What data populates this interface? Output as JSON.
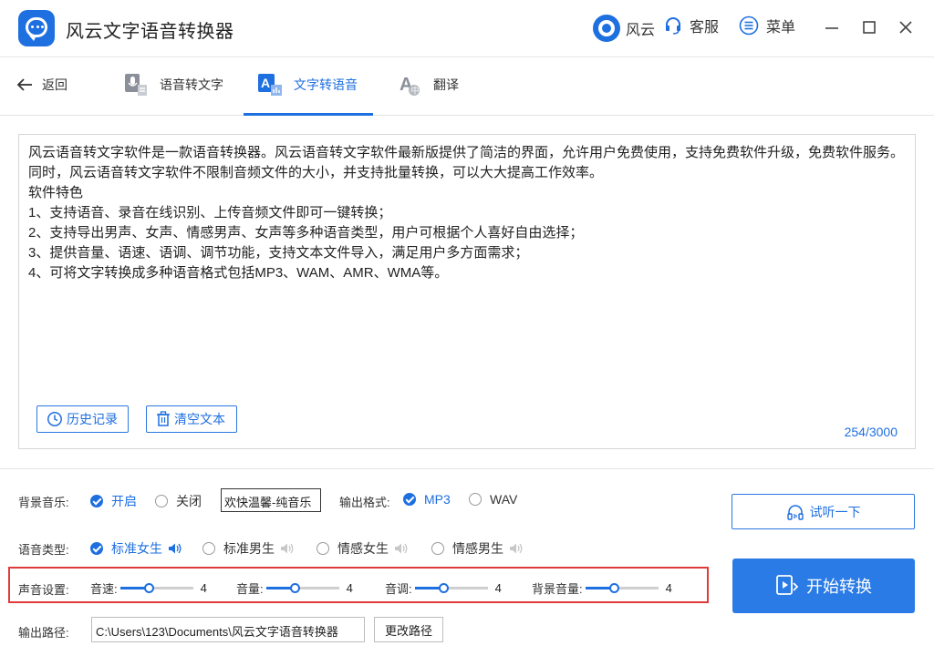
{
  "app": {
    "title": "风云文字语音转换器",
    "fengyun_label": "风云",
    "service_label": "客服",
    "menu_label": "菜单",
    "accent_color": "#1e6fe0",
    "highlight_color": "#e03b3b"
  },
  "nav": {
    "back_label": "返回",
    "tabs": [
      {
        "label": "语音转文字",
        "icon": "speech-to-text-icon",
        "active": false
      },
      {
        "label": "文字转语音",
        "icon": "text-to-speech-icon",
        "active": true
      },
      {
        "label": "翻译",
        "icon": "translate-icon",
        "active": false
      }
    ]
  },
  "editor": {
    "lines": [
      "风云语音转文字软件是一款语音转换器。风云语音转文字软件最新版提供了简洁的界面，允许用户免费使用，支持免费软件升级，免费软件服务。同时，风云语音转文字软件不限制音频文件的大小，并支持批量转换，可以大大提高工作效率。",
      "软件特色",
      "1、支持语音、录音在线识别、上传音频文件即可一键转换；",
      "2、支持导出男声、女声、情感男声、女声等多种语音类型，用户可根据个人喜好自由选择；",
      "3、提供音量、语速、语调、调节功能，支持文本文件导入，满足用户多方面需求；",
      "4、可将文字转换成多种语音格式包括MP3、WAM、AMR、WMA等。"
    ],
    "history_label": "历史记录",
    "clear_label": "清空文本",
    "counter": "254/3000"
  },
  "settings": {
    "bg_music_label": "背景音乐:",
    "bg_on_label": "开启",
    "bg_off_label": "关闭",
    "bg_music_selected": "欢快温馨-纯音乐",
    "output_format_label": "输出格式:",
    "format_mp3": "MP3",
    "format_wav": "WAV",
    "voice_type_label": "语音类型:",
    "voice_types": [
      {
        "label": "标准女生",
        "checked": true
      },
      {
        "label": "标准男生",
        "checked": false
      },
      {
        "label": "情感女生",
        "checked": false
      },
      {
        "label": "情感男生",
        "checked": false
      }
    ],
    "sound_settings_label": "声音设置:",
    "sliders": [
      {
        "label": "音速:",
        "value": "4",
        "fraction": 0.4
      },
      {
        "label": "音量:",
        "value": "4",
        "fraction": 0.4
      },
      {
        "label": "音调:",
        "value": "4",
        "fraction": 0.4
      },
      {
        "label": "背景音量:",
        "value": "4",
        "fraction": 0.4
      }
    ],
    "output_path_label": "输出路径:",
    "output_path": "C:\\Users\\123\\Documents\\风云文字语音转换器",
    "change_path_label": "更改路径"
  },
  "actions": {
    "preview_label": "试听一下",
    "start_label": "开始转换"
  }
}
